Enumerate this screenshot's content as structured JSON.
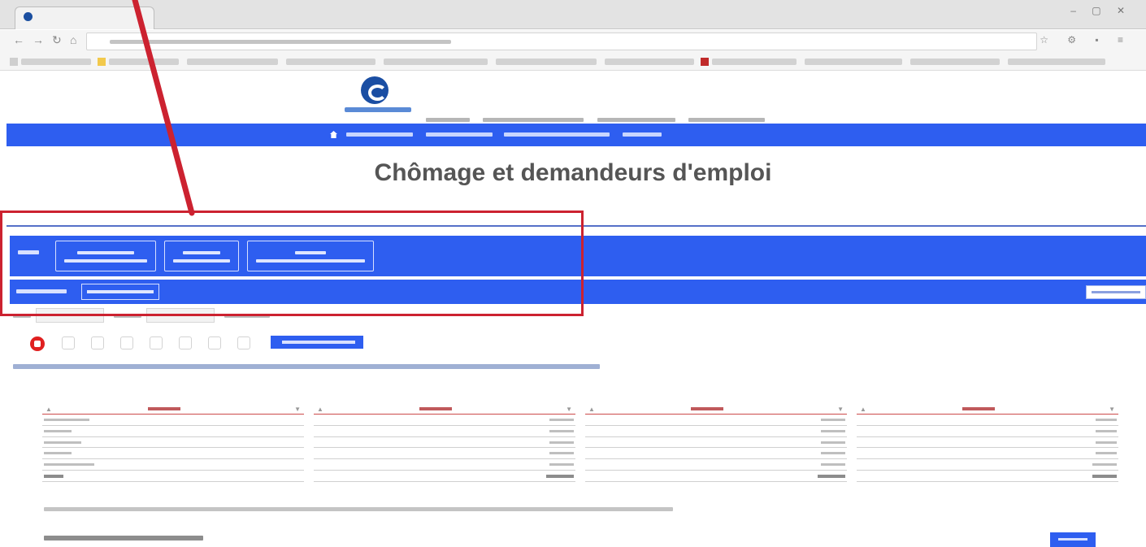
{
  "page": {
    "title": "Chômage et demandeurs d'emploi"
  },
  "table": {
    "columns": [
      {
        "rows": 7
      },
      {
        "rows": 7
      },
      {
        "rows": 7
      },
      {
        "rows": 7
      }
    ]
  },
  "annotation": {
    "color": "#cc2230"
  },
  "colors": {
    "brand_blue": "#2e5ef0",
    "logo_blue": "#1a4ea3"
  },
  "icons": {
    "browser": [
      "back-icon",
      "forward-icon",
      "reload-icon",
      "home-icon"
    ],
    "tools": [
      "stop-icon",
      "tool-icon-1",
      "tool-icon-2",
      "tool-icon-3",
      "tool-icon-4",
      "tool-icon-5",
      "tool-icon-6",
      "tool-icon-7"
    ]
  }
}
